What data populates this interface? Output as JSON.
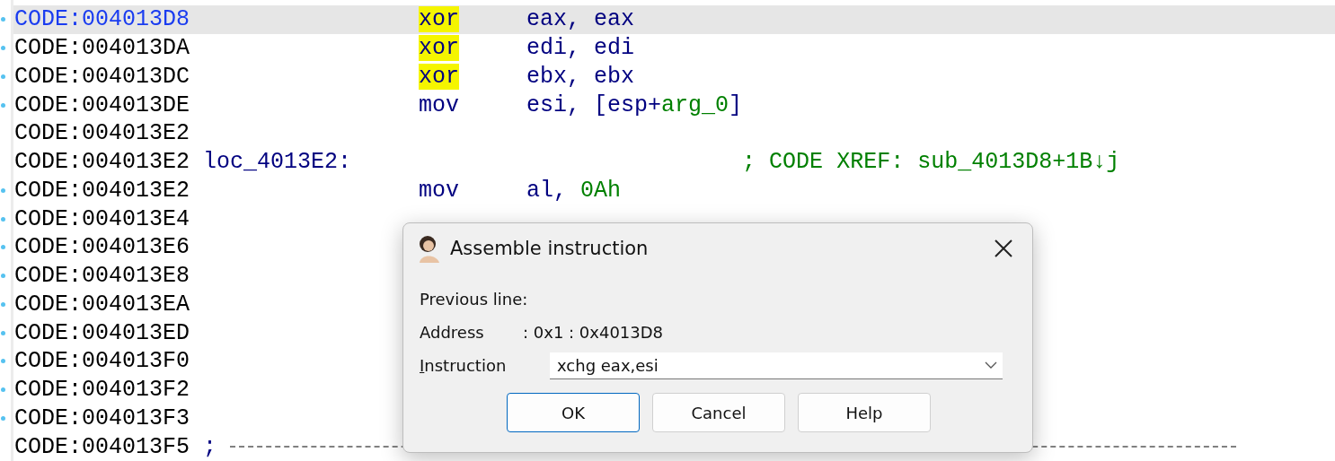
{
  "listing": {
    "rows": [
      {
        "address": "CODE:004013D8",
        "selected": true,
        "marked": true,
        "mnemonic": "xor",
        "highlight": true,
        "operands": [
          {
            "text": "eax, eax",
            "kind": "plain"
          }
        ]
      },
      {
        "address": "CODE:004013DA",
        "selected": false,
        "marked": true,
        "mnemonic": "xor",
        "highlight": true,
        "operands": [
          {
            "text": "edi, edi",
            "kind": "plain"
          }
        ]
      },
      {
        "address": "CODE:004013DC",
        "selected": false,
        "marked": true,
        "mnemonic": "xor",
        "highlight": true,
        "operands": [
          {
            "text": "ebx, ebx",
            "kind": "plain"
          }
        ]
      },
      {
        "address": "CODE:004013DE",
        "selected": false,
        "marked": true,
        "mnemonic": "mov",
        "highlight": false,
        "operands": [
          {
            "text": "esi, [esp+",
            "kind": "plain"
          },
          {
            "text": "arg_0",
            "kind": "var"
          },
          {
            "text": "]",
            "kind": "plain"
          }
        ]
      },
      {
        "address": "CODE:004013E2",
        "selected": false,
        "marked": false
      },
      {
        "address": "CODE:004013E2",
        "selected": false,
        "marked": false,
        "label": "loc_4013E2:",
        "comment": "; CODE XREF: sub_4013D8+1B↓j"
      },
      {
        "address": "CODE:004013E2",
        "selected": false,
        "marked": true,
        "mnemonic": "mov",
        "highlight": false,
        "operands": [
          {
            "text": "al, ",
            "kind": "plain"
          },
          {
            "text": "0Ah",
            "kind": "var"
          }
        ]
      },
      {
        "address": "CODE:004013E4",
        "selected": false,
        "marked": true
      },
      {
        "address": "CODE:004013E6",
        "selected": false,
        "marked": true
      },
      {
        "address": "CODE:004013E8",
        "selected": false,
        "marked": true
      },
      {
        "address": "CODE:004013EA",
        "selected": false,
        "marked": true
      },
      {
        "address": "CODE:004013ED",
        "selected": false,
        "marked": true
      },
      {
        "address": "CODE:004013F0",
        "selected": false,
        "marked": true
      },
      {
        "address": "CODE:004013F2",
        "selected": false,
        "marked": true
      },
      {
        "address": "CODE:004013F3",
        "selected": false,
        "marked": true
      },
      {
        "address": "CODE:004013F5",
        "selected": false,
        "marked": false,
        "separator": ";"
      }
    ]
  },
  "dialog": {
    "title": "Assemble instruction",
    "heading": "Previous line:",
    "address": {
      "label": "Address",
      "value": ": 0x1 : 0x4013D8"
    },
    "instruction": {
      "label": "Instruction",
      "value": "xchg eax,esi"
    },
    "buttons": [
      {
        "label": "OK",
        "default": true
      },
      {
        "label": "Cancel",
        "default": false
      },
      {
        "label": "Help",
        "default": false
      }
    ]
  }
}
